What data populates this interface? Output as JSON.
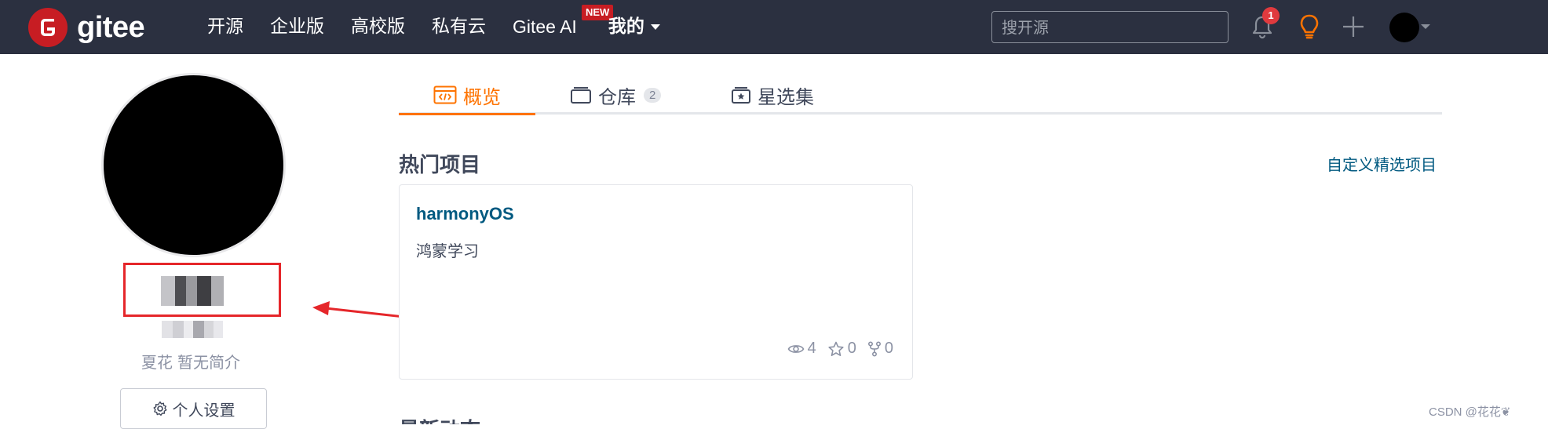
{
  "navbar": {
    "logo_text": "gitee",
    "menu": [
      "开源",
      "企业版",
      "高校版",
      "私有云"
    ],
    "ai_label": "Gitee AI",
    "new_badge": "NEW",
    "mine_label": "我的",
    "search_placeholder": "搜开源",
    "notification_count": "1",
    "icons": [
      "bell-icon",
      "lightbulb-icon",
      "plus-icon"
    ]
  },
  "profile": {
    "bio_prefix": "夏花",
    "bio_text": "暂无简介",
    "settings_label": "个人设置"
  },
  "tabs": {
    "overview": "概览",
    "repos": "仓库",
    "repos_count": "2",
    "stars": "星选集"
  },
  "popular": {
    "title": "热门项目",
    "customize_link": "自定义精选项目",
    "project": {
      "name": "harmonyOS",
      "description": "鸿蒙学习",
      "watch_count": "4",
      "star_count": "0",
      "fork_count": "0"
    }
  },
  "next_section_title": "最新动态",
  "watermark": "CSDN @花花❦",
  "colors": {
    "navbar_bg": "#2b3040",
    "brand_red": "#c71d23",
    "accent_orange": "#fe7300",
    "link_blue": "#005980",
    "annotation_red": "#e5262a"
  }
}
